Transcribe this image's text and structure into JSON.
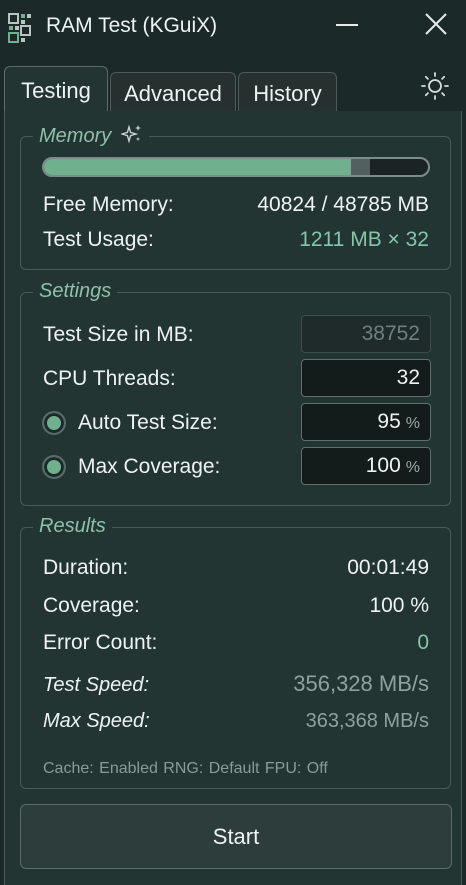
{
  "window": {
    "title": "RAM Test (KGuiX)",
    "minimize_icon": "minimize-icon",
    "close_icon": "close-icon"
  },
  "tabs": [
    {
      "label": "Testing",
      "active": true
    },
    {
      "label": "Advanced",
      "active": false
    },
    {
      "label": "History",
      "active": false
    }
  ],
  "theme_icon": "sun-icon",
  "memory": {
    "title": "Memory",
    "title_icon": "sparkle-icon",
    "bar_fill_fraction": 0.8,
    "bar_used_fraction": 0.05,
    "free_label": "Free Memory:",
    "free_value": "40824 / 48785 MB",
    "usage_label": "Test Usage:",
    "usage_value": "1211 MB × 32"
  },
  "settings": {
    "title": "Settings",
    "test_size_label": "Test Size in MB:",
    "test_size_value": "38752",
    "cpu_threads_label": "CPU Threads:",
    "cpu_threads_value": "32",
    "auto_test_size_label": "Auto Test Size:",
    "auto_test_size_value": "95",
    "max_coverage_label": "Max Coverage:",
    "max_coverage_value": "100",
    "percent_unit": "%"
  },
  "results": {
    "title": "Results",
    "duration_label": "Duration:",
    "duration_value": "00:01:49",
    "coverage_label": "Coverage:",
    "coverage_value": "100 %",
    "error_label": "Error Count:",
    "error_value": "0",
    "test_speed_label": "Test Speed:",
    "test_speed_value": "356,328 MB/s",
    "max_speed_label": "Max Speed:",
    "max_speed_value": "363,368 MB/s",
    "footer": "Cache: Enabled  RNG: Default  FPU: Off"
  },
  "start_label": "Start",
  "colors": {
    "background": "#1b2a29",
    "accent": "#6fb08f",
    "accent_text": "#86c5a8"
  }
}
